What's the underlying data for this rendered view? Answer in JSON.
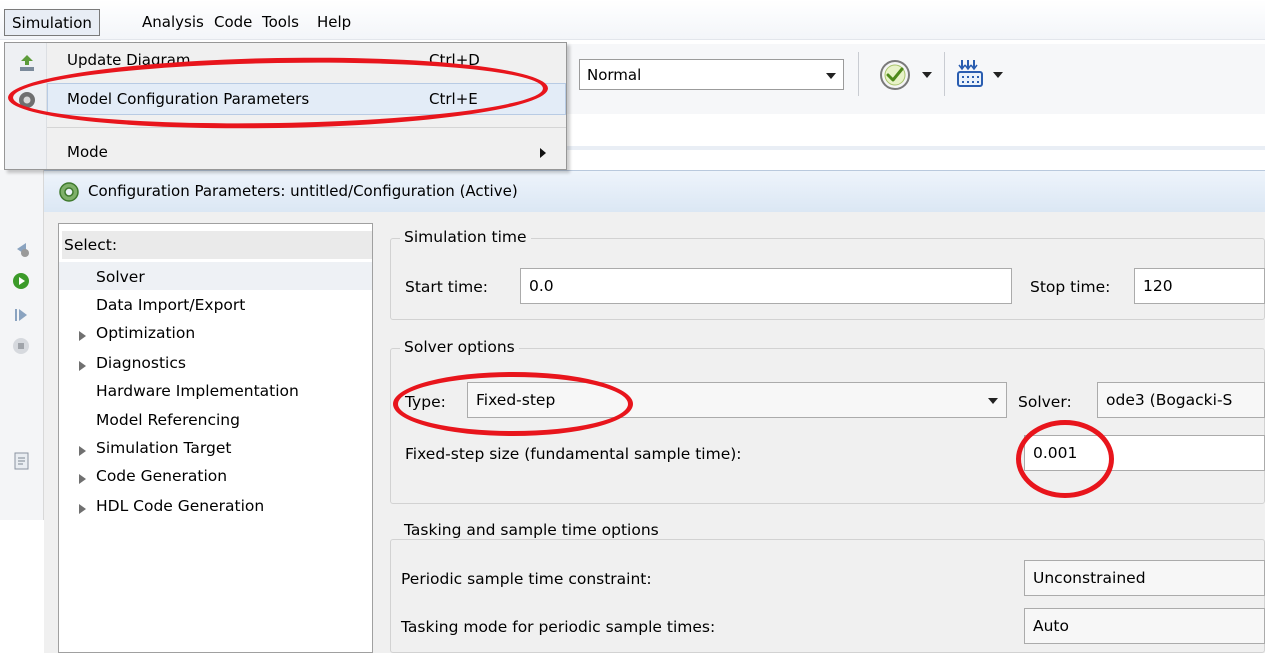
{
  "menubar": {
    "items": [
      "Simulation",
      "Analysis",
      "Code",
      "Tools",
      "Help"
    ],
    "active": "Simulation"
  },
  "toolbar": {
    "mode_value": "Normal"
  },
  "dropdown": {
    "items": [
      {
        "label": "Update Diagram",
        "shortcut": "Ctrl+D"
      },
      {
        "label": "Model Configuration Parameters",
        "shortcut": "Ctrl+E"
      },
      {
        "label": "Mode",
        "shortcut": ""
      }
    ]
  },
  "config": {
    "title": "Configuration Parameters: untitled/Configuration (Active)",
    "select_label": "Select:",
    "tree": [
      "Solver",
      "Data Import/Export",
      "Optimization",
      "Diagnostics",
      "Hardware Implementation",
      "Model Referencing",
      "Simulation Target",
      "Code Generation",
      "HDL Code Generation"
    ],
    "simulation_time": {
      "title": "Simulation time",
      "start_label": "Start time:",
      "start_value": "0.0",
      "stop_label": "Stop time:",
      "stop_value": "120"
    },
    "solver_options": {
      "title": "Solver options",
      "type_label": "Type:",
      "type_value": "Fixed-step",
      "solver_label": "Solver:",
      "solver_value": "ode3 (Bogacki-S",
      "step_label": "Fixed-step size (fundamental sample time):",
      "step_value": "0.001"
    },
    "tasking": {
      "title": "Tasking and sample time options",
      "constraint_label": "Periodic sample time constraint:",
      "constraint_value": "Unconstrained",
      "mode_label": "Tasking mode for periodic sample times:",
      "mode_value": "Auto"
    }
  },
  "colors": {
    "annotation": "#e8151c",
    "highlight": "#e3ecf7"
  }
}
